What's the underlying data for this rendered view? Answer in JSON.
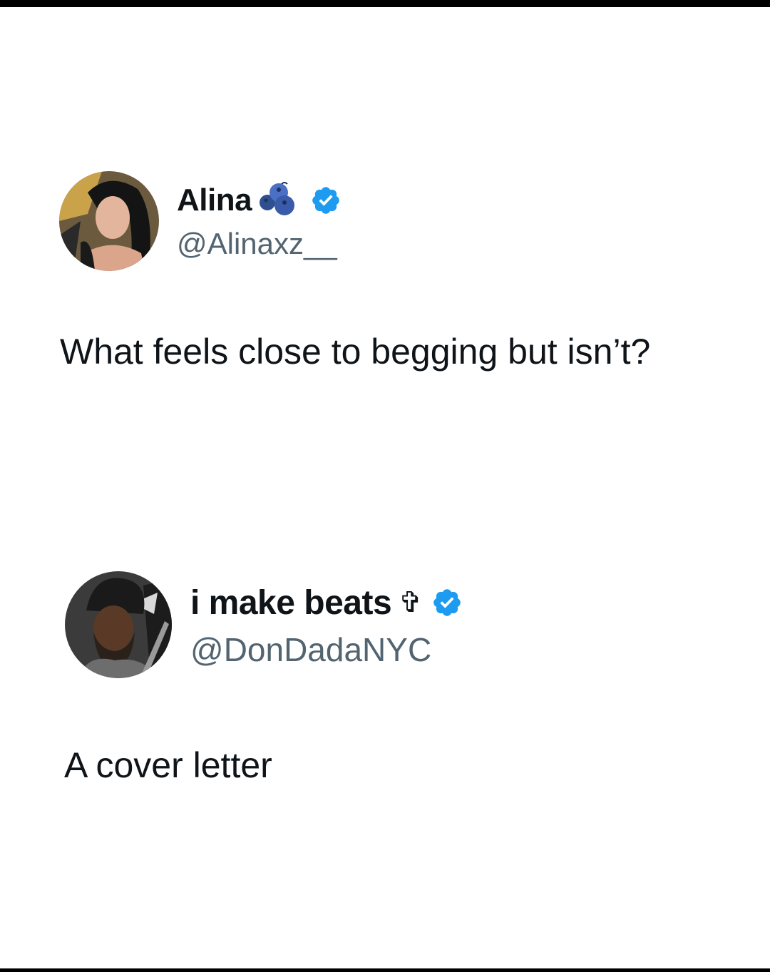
{
  "tweets": [
    {
      "display_name": "Alina",
      "name_emoji": "blueberries-icon",
      "verified": true,
      "handle": "@Alinaxz__",
      "text": "What feels close to begging but isn’t?"
    },
    {
      "display_name": "i make beats",
      "name_emoji": "✞",
      "verified": true,
      "handle": "@DonDadaNYC",
      "text": "A cover letter"
    }
  ],
  "colors": {
    "verified_blue": "#1d9bf0",
    "handle_gray": "#536471",
    "text": "#0f1419",
    "background": "#ffffff",
    "frame": "#000000"
  }
}
